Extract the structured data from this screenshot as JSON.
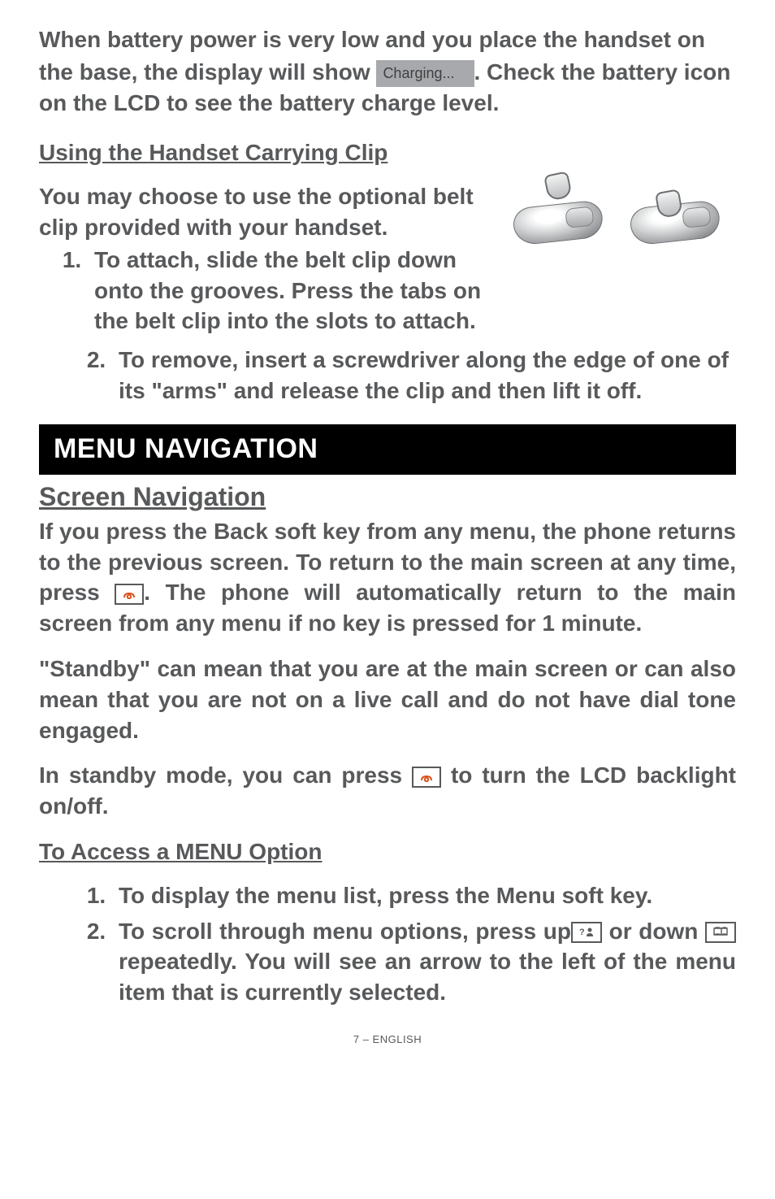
{
  "paragraph_top_a": "When battery power is very low and you place the handset on",
  "paragraph_top_b_pre": "the base, the display will show ",
  "charging_badge": "Charging...",
  "paragraph_top_b_post": ".  Check the battery icon on the LCD to see the battery charge level.",
  "subhead_clip": "Using the Handset Carrying Clip",
  "clip_intro": "You may choose to use the optional belt clip provided with your handset.",
  "clip_list_1_a": "To attach, slide the belt clip down onto the grooves.  Press the tabs on the belt clip into the slots to attach.",
  "clip_list_2": "To remove, insert a screwdriver along the edge of one of its \"arms\" and release the clip and then lift it off.",
  "section_bar": "MENU NAVIGATION",
  "section_sub": "Screen Navigation",
  "nav_para_pre": "If you press the ",
  "nav_back": "Back",
  "nav_para_mid": " soft key from any menu, the phone returns to the previous screen.  To return to the main screen at any time, press ",
  "nav_para_post": ".  The phone will automatically return to the main screen from any menu if no key is pressed for 1 minute.",
  "standby_label": "\"Standby\"",
  "standby_rest": " can mean that you are at the main screen or can also mean that you are not on a live call and do not have dial tone engaged.",
  "backlight_pre": "In standby mode, you can press ",
  "backlight_post": " to turn the LCD backlight on/off.",
  "subhead_menu": "To Access a MENU Option",
  "menu_list_1_pre": "To display the menu list, press the ",
  "menu_word": "Menu",
  "menu_list_1_post": " soft key.",
  "menu_list_2_pre": "To scroll through menu options, press up",
  "menu_list_2_mid": " or down ",
  "menu_list_2_post": " repeatedly.  You will see an arrow to the left of the menu item that is currently selected.",
  "footer": "7 – ENGLISH"
}
